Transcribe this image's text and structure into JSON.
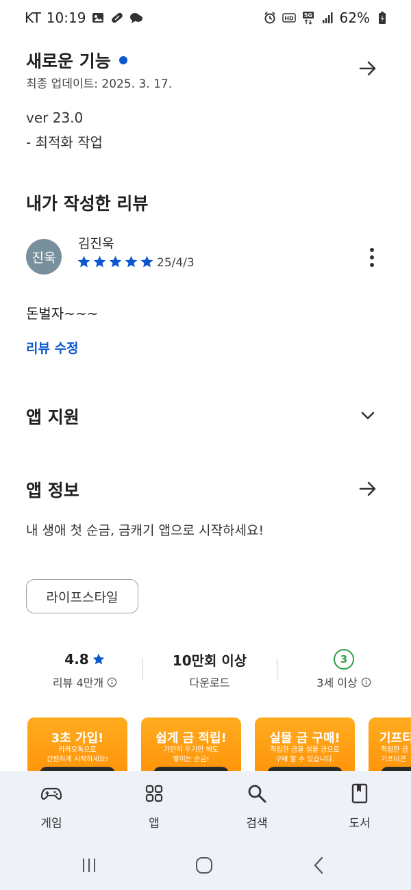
{
  "status_bar": {
    "carrier": "KT",
    "time": "10:19",
    "battery": "62%",
    "left_icons": [
      "gallery-icon",
      "pill-icon",
      "chat-icon"
    ],
    "right_icons": [
      "alarm-icon",
      "hd-icon",
      "5g-icon",
      "signal-icon",
      "battery-icon"
    ]
  },
  "whats_new": {
    "title": "새로운 기능",
    "updated": "최종 업데이트: 2025. 3. 17.",
    "version": "ver 23.0",
    "notes": "- 최적화 작업",
    "accent_color": "#0b57d0"
  },
  "my_review": {
    "title": "내가 작성한 리뷰",
    "avatar_text": "진욱",
    "author": "김진욱",
    "rating": 5,
    "date": "25/4/3",
    "text": "돈벌자~~~",
    "edit_label": "리뷰 수정"
  },
  "app_support": {
    "title": "앱 지원"
  },
  "app_info": {
    "title": "앱 정보",
    "description": "내 생애 첫 순금, 금캐기 앱으로 시작하세요!",
    "category_chip": "라이프스타일"
  },
  "stats": {
    "rating_value": "4.8",
    "rating_label": "리뷰 4만개",
    "downloads_value": "10만회 이상",
    "downloads_label": "다운로드",
    "age_badge": "3",
    "age_label": "3세 이상"
  },
  "screenshots": [
    {
      "title": "3초 가입!",
      "subtitle": "카카오톡으로\n간편하게 시작하세요!"
    },
    {
      "title": "쉽게 금 적립!",
      "subtitle": "가만히 두기만 해도\n쌓이는 순금!"
    },
    {
      "title": "실물 금 구매!",
      "subtitle": "적립한 금을 실물 금으로\n구매 할 수 있습니다."
    },
    {
      "title": "기프티",
      "subtitle": "적립한 금\n기프티콘"
    }
  ],
  "bottom_nav": {
    "items": [
      {
        "label": "게임",
        "icon": "gamepad-icon"
      },
      {
        "label": "앱",
        "icon": "apps-grid-icon"
      },
      {
        "label": "검색",
        "icon": "search-icon"
      },
      {
        "label": "도서",
        "icon": "book-icon"
      }
    ]
  },
  "system_nav": {
    "buttons": [
      "recents-button",
      "home-button",
      "back-button"
    ]
  }
}
